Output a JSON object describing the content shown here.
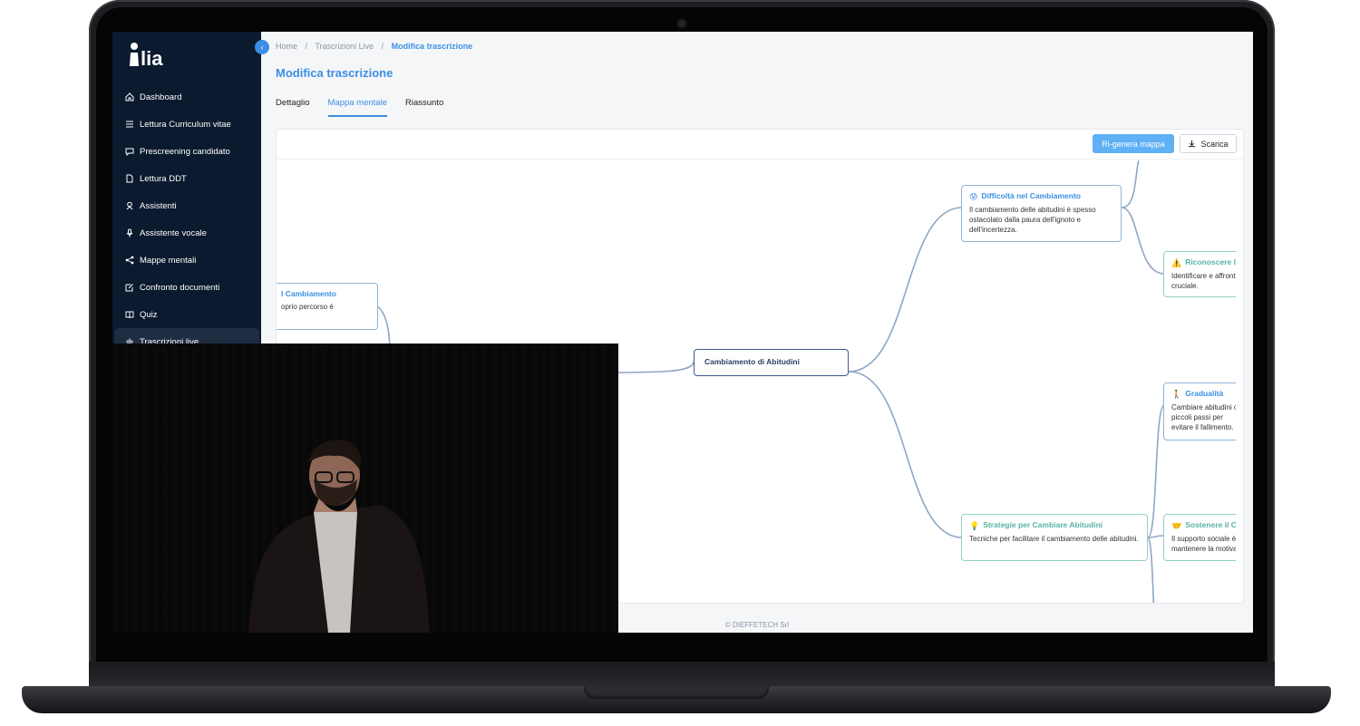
{
  "app": {
    "logo_text": "lia",
    "collapse_icon": "chevron-left-icon"
  },
  "sidebar": {
    "items": [
      {
        "label": "Dashboard",
        "icon": "home-icon"
      },
      {
        "label": "Lettura Curriculum vitae",
        "icon": "list-icon"
      },
      {
        "label": "Prescreening candidato",
        "icon": "chat-icon"
      },
      {
        "label": "Lettura DDT",
        "icon": "document-icon"
      },
      {
        "label": "Assistenti",
        "icon": "assistant-icon"
      },
      {
        "label": "Assistente vocale",
        "icon": "microphone-icon"
      },
      {
        "label": "Mappe mentali",
        "icon": "share-nodes-icon"
      },
      {
        "label": "Confronto documenti",
        "icon": "edit-document-icon"
      },
      {
        "label": "Quiz",
        "icon": "book-icon"
      },
      {
        "label": "Trascrizioni live",
        "icon": "waveform-icon",
        "active": true
      }
    ]
  },
  "breadcrumb": {
    "home": "Home",
    "sep1": "/",
    "section": "Trascrizioni Live",
    "sep2": "/",
    "current": "Modifica trascrizione"
  },
  "page": {
    "title": "Modifica trascrizione",
    "tabs": [
      {
        "label": "Dettaglio"
      },
      {
        "label": "Mappa mentale",
        "active": true
      },
      {
        "label": "Riassunto"
      }
    ]
  },
  "toolbar": {
    "regen_label": "Ri-genera mappa",
    "download_label": "Scarica",
    "download_icon": "download-icon"
  },
  "mindmap": {
    "root": "Cambiamento di Abitudini",
    "left_node": {
      "title": "l Cambiamento",
      "desc": "oprio percorso è"
    },
    "difficulty": {
      "emoji": "😰",
      "title": "Difficoltà nel Cambiamento",
      "desc": "Il cambiamento delle abitudini è spesso ostacolato dalla paura dell'ignoto e dell'incertezza."
    },
    "recognize": {
      "emoji": "⚠️",
      "title": "Riconoscere le",
      "desc": "Identificare e affront cruciale."
    },
    "strategies": {
      "emoji": "💡",
      "title": "Strategie per Cambiare Abitudini",
      "desc": "Tecniche per facilitare il cambiamento delle abitudini."
    },
    "gradual": {
      "emoji": "🚶",
      "title": "Gradualità",
      "desc": "Cambiare abitudini con piccoli passi per evitare il fallimento."
    },
    "support": {
      "emoji": "🤝",
      "title": "Sostenere il Ca",
      "desc": "Il supporto sociale è mantenere la motiva"
    }
  },
  "footer": {
    "text": "© DIEFFETECH Srl"
  },
  "colors": {
    "sidebar_bg": "#0b1a2e",
    "accent": "#3b8fe3",
    "regen_button": "#5fb0f5",
    "link_stroke": "#8fa6c4"
  }
}
